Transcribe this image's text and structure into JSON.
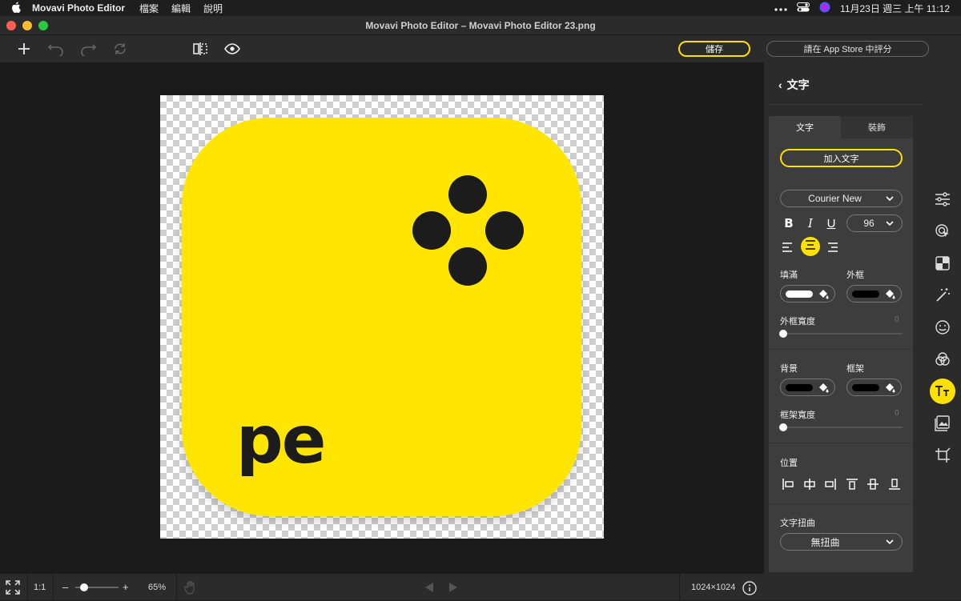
{
  "menubar": {
    "apple": "",
    "app_name": "Movavi Photo Editor",
    "items": [
      {
        "label": "檔案"
      },
      {
        "label": "編輯"
      },
      {
        "label": "說明"
      }
    ],
    "clock": "11月23日 週三 上午 11:12"
  },
  "window": {
    "title": "Movavi Photo Editor – Movavi Photo Editor 23.png"
  },
  "toolbar": {
    "save_label": "儲存",
    "rate_label": "請在 App Store 中評分"
  },
  "canvas": {
    "logo_text": "pe"
  },
  "statusbar": {
    "ratio_label": "1:1",
    "zoom_minus": "–",
    "zoom_plus": "+",
    "zoom_value": "65%",
    "zoom_fraction": 0.2,
    "dimensions": "1024×1024"
  },
  "panel": {
    "back": "‹",
    "title": "文字",
    "tabs": [
      {
        "label": "文字"
      },
      {
        "label": "裝飾"
      }
    ],
    "add_text": "加入文字",
    "font": "Courier New",
    "size": "96",
    "bold": "B",
    "italic": "I",
    "underline": "U",
    "fill_label": "填滿",
    "stroke_label": "外框",
    "stroke_width_label": "外框寬度",
    "stroke_width_value": "0",
    "background_label": "背景",
    "frame_label": "框架",
    "frame_width_label": "框架寬度",
    "frame_width_value": "0",
    "position_label": "位置",
    "warp_label": "文字扭曲",
    "warp_value": "無扭曲"
  },
  "colors": {
    "accent": "#ffe000",
    "fill": "#ffffff",
    "stroke": "#000000",
    "background": "#000000",
    "frame": "#000000"
  }
}
